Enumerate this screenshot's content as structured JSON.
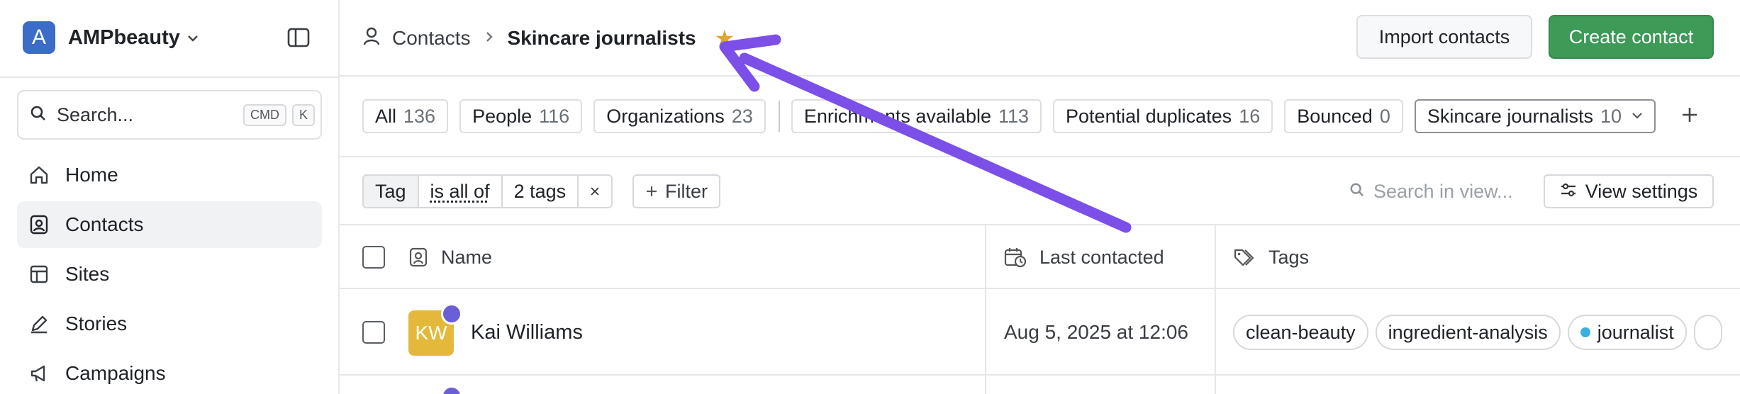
{
  "sidebar": {
    "workspace": {
      "initial": "A",
      "name": "AMPbeauty"
    },
    "search": {
      "placeholder": "Search...",
      "shortcut_1": "CMD",
      "shortcut_2": "K"
    },
    "nav": [
      {
        "label": "Home",
        "icon": "home-icon"
      },
      {
        "label": "Contacts",
        "icon": "contacts-icon",
        "active": true
      },
      {
        "label": "Sites",
        "icon": "sites-icon"
      },
      {
        "label": "Stories",
        "icon": "pen-icon"
      },
      {
        "label": "Campaigns",
        "icon": "megaphone-icon"
      }
    ]
  },
  "header": {
    "breadcrumb_root": "Contacts",
    "breadcrumb_current": "Skincare journalists",
    "star_glyph": "★",
    "import_label": "Import contacts",
    "create_label": "Create contact"
  },
  "views": [
    {
      "label": "All",
      "count": "136"
    },
    {
      "label": "People",
      "count": "116"
    },
    {
      "label": "Organizations",
      "count": "23"
    },
    {
      "label": "Enrichments available",
      "count": "113"
    },
    {
      "label": "Potential duplicates",
      "count": "16"
    },
    {
      "label": "Bounced",
      "count": "0"
    },
    {
      "label": "Skincare journalists",
      "count": "10",
      "selected": true
    }
  ],
  "filter": {
    "field": "Tag",
    "operator": "is all of",
    "value": "2 tags",
    "add_filter_label": "Filter",
    "search_placeholder": "Search in view...",
    "view_settings_label": "View settings"
  },
  "table": {
    "columns": [
      "Name",
      "Last contacted",
      "Tags"
    ],
    "rows": [
      {
        "initials": "KW",
        "name": "Kai Williams",
        "last_contacted": "Aug 5, 2025 at 12:06",
        "tags": [
          {
            "label": "clean-beauty"
          },
          {
            "label": "ingredient-analysis"
          },
          {
            "label": "journalist",
            "dot_color": "#3ab0e0"
          }
        ]
      }
    ]
  },
  "colors": {
    "accent_green": "#3d9a57",
    "workspace_blue": "#3b6cc7",
    "star": "#e0a430",
    "annotation_arrow": "#7b4fe8",
    "avatar_yellow": "#e4b93b",
    "org_badge": "#6b5fd8"
  }
}
